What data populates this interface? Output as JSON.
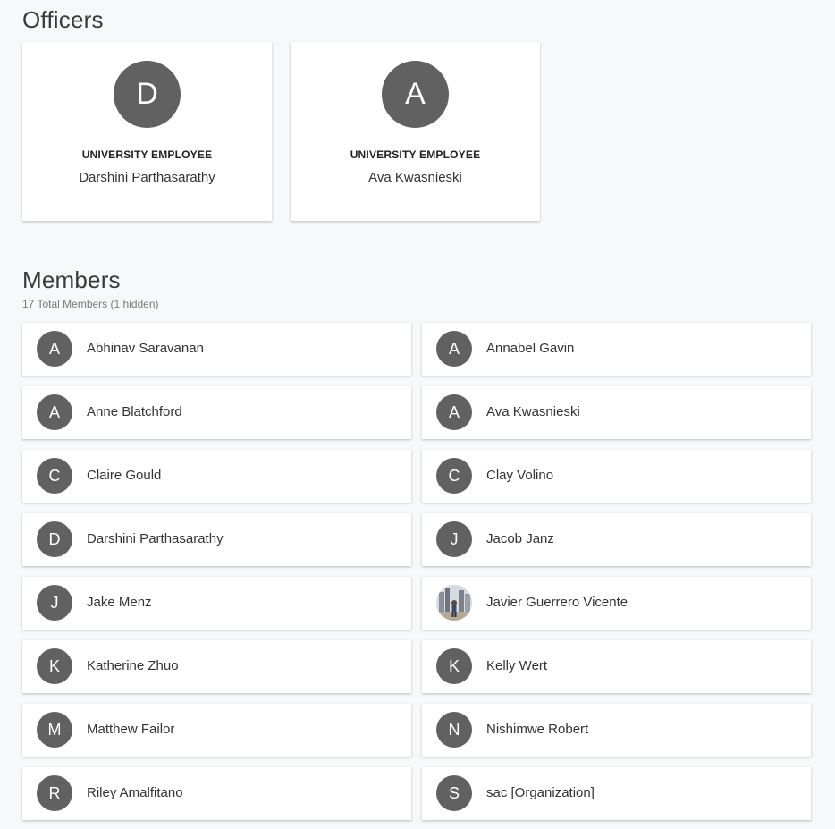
{
  "officers": {
    "title": "Officers",
    "items": [
      {
        "initial": "D",
        "role": "UNIVERSITY EMPLOYEE",
        "name": "Darshini Parthasarathy"
      },
      {
        "initial": "A",
        "role": "UNIVERSITY EMPLOYEE",
        "name": "Ava Kwasnieski"
      }
    ]
  },
  "members": {
    "title": "Members",
    "subtitle": "17 Total Members (1 hidden)",
    "items": [
      {
        "initial": "A",
        "name": "Abhinav Saravanan"
      },
      {
        "initial": "A",
        "name": "Annabel Gavin"
      },
      {
        "initial": "A",
        "name": "Anne Blatchford"
      },
      {
        "initial": "A",
        "name": "Ava Kwasnieski"
      },
      {
        "initial": "C",
        "name": "Claire Gould"
      },
      {
        "initial": "C",
        "name": "Clay Volino"
      },
      {
        "initial": "D",
        "name": "Darshini Parthasarathy"
      },
      {
        "initial": "J",
        "name": "Jacob Janz"
      },
      {
        "initial": "J",
        "name": "Jake Menz"
      },
      {
        "initial": "",
        "name": "Javier Guerrero Vicente",
        "avatar": "photo"
      },
      {
        "initial": "K",
        "name": "Katherine Zhuo"
      },
      {
        "initial": "K",
        "name": "Kelly Wert"
      },
      {
        "initial": "M",
        "name": "Matthew Failor"
      },
      {
        "initial": "N",
        "name": "Nishimwe Robert"
      },
      {
        "initial": "R",
        "name": "Riley Amalfitano"
      },
      {
        "initial": "S",
        "name": "sac [Organization]"
      }
    ]
  },
  "colors": {
    "avatar_bg": "#616161",
    "page_bg": "#f7f8fa",
    "card_bg": "#ffffff"
  }
}
